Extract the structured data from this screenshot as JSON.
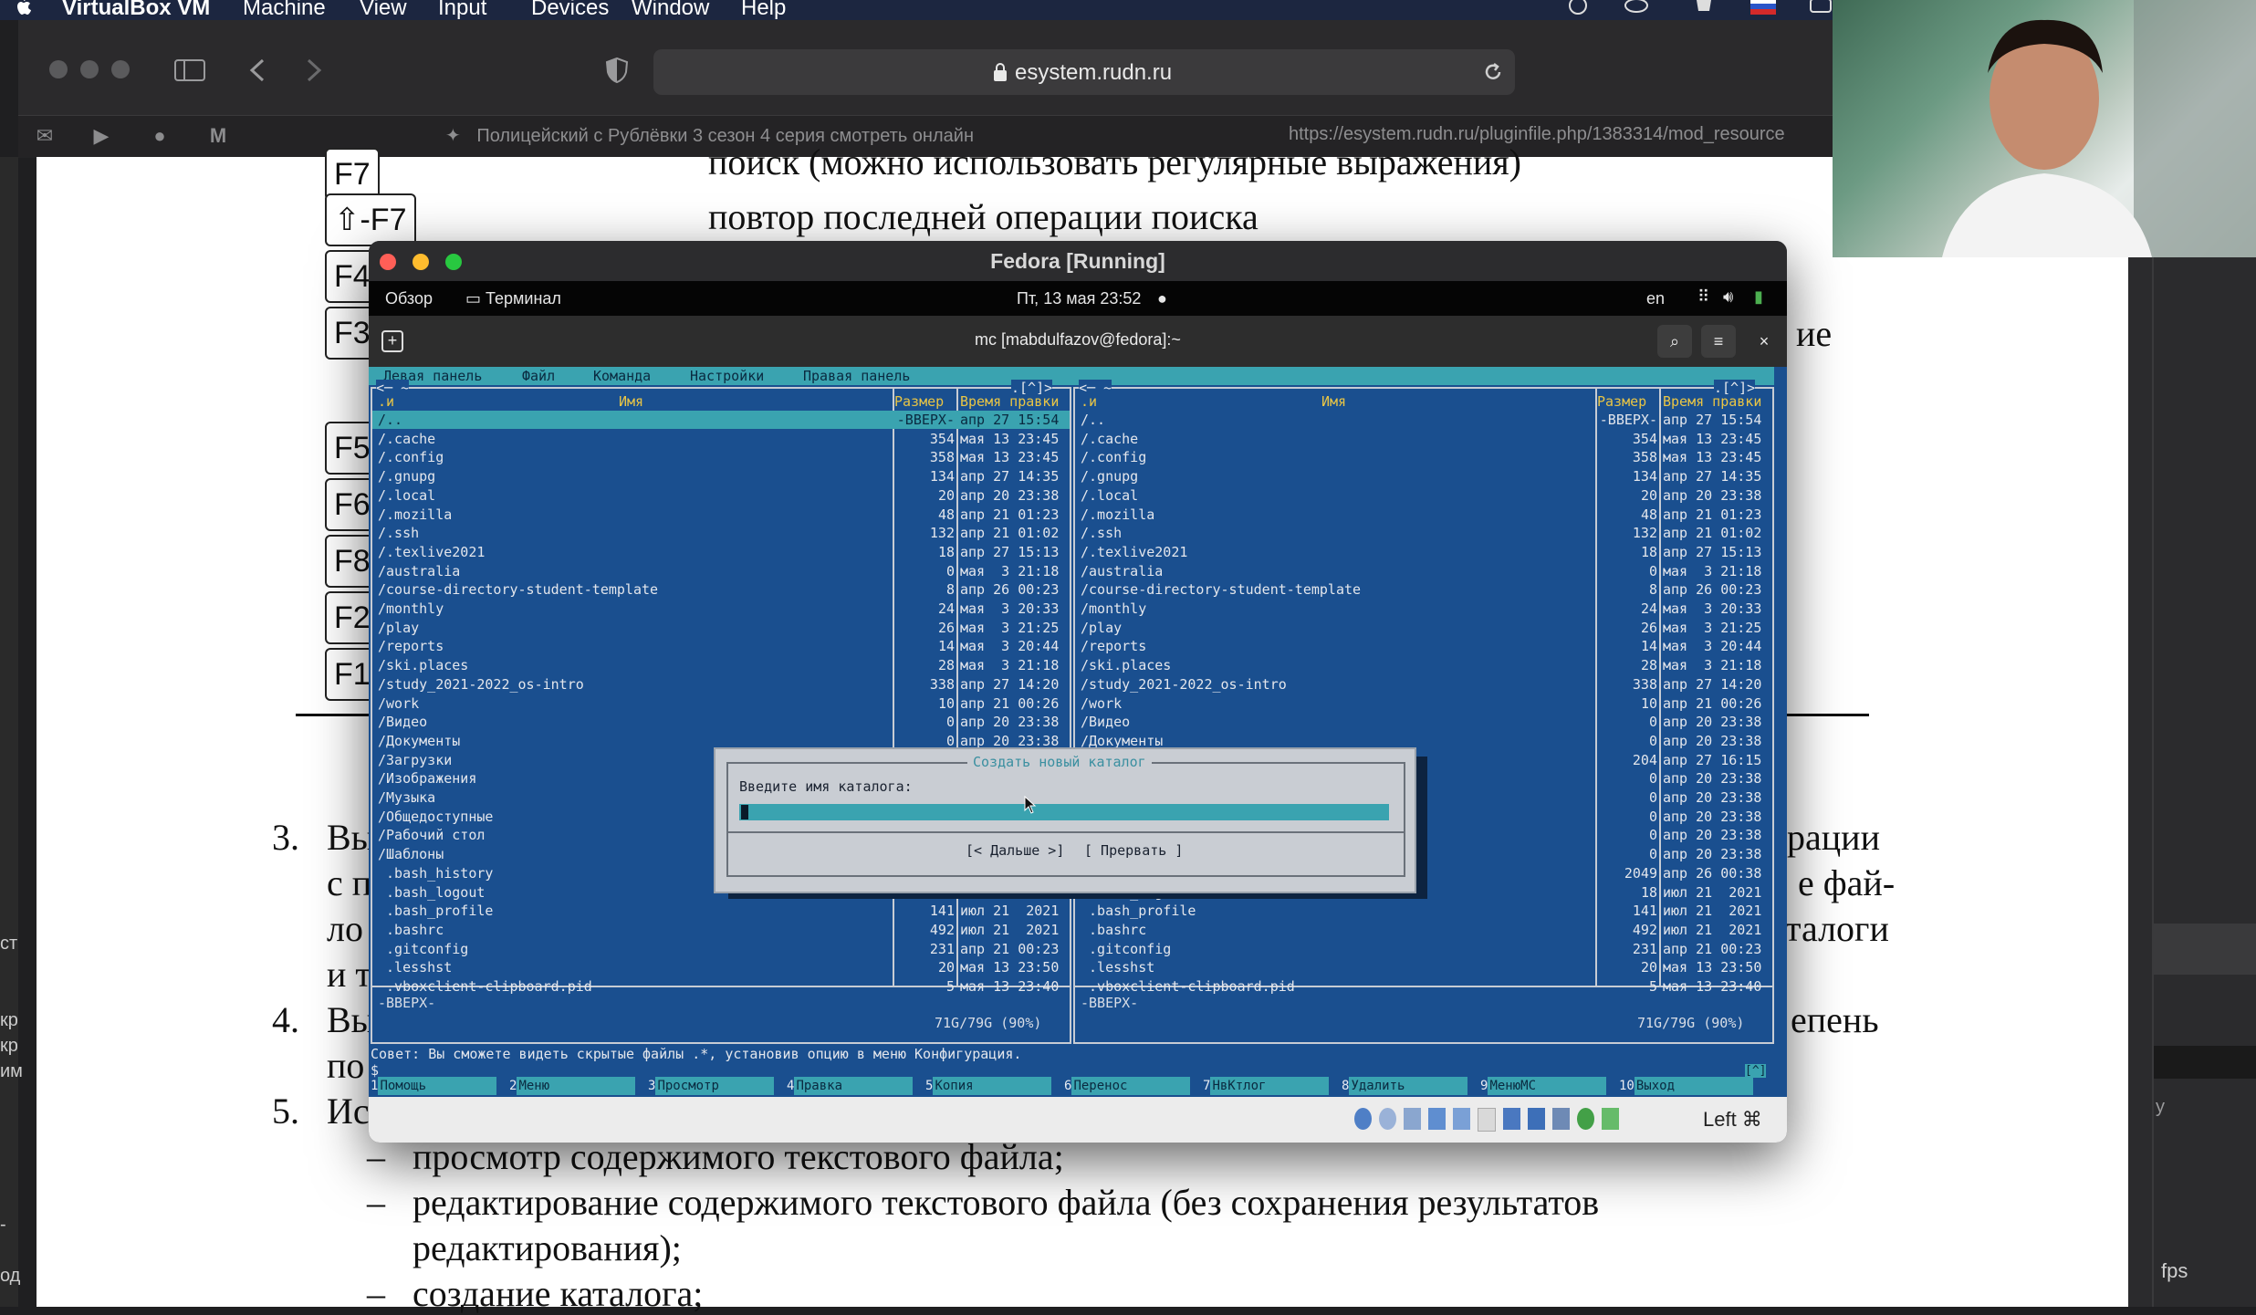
{
  "menubar": {
    "app": "VirtualBox VM",
    "items": [
      "Machine",
      "View",
      "Input",
      "Devices",
      "Window",
      "Help"
    ]
  },
  "browser": {
    "address": "esystem.rudn.ru",
    "tab_left": "Полицейский с Рублёвки 3 сезон 4 серия смотреть онлайн",
    "tab_right": "https://esystem.rudn.ru/pluginfile.php/1383314/mod_resource"
  },
  "doc": {
    "fkeys": [
      "F7",
      "⇧-F7",
      "F4",
      "F3",
      "F5",
      "F6",
      "F8",
      "F2",
      "F1"
    ],
    "line_search": "поиск (можно использовать регулярные выражения)",
    "line_repeat": "повтор последней операции поиска",
    "frag_ie": "ие",
    "item3_num": "3.",
    "item3_a": "Вы",
    "item3_b": "с п",
    "item3_c": "ло",
    "item3_d": "и т",
    "item3_r1": "рации",
    "item3_r2": "е фай-",
    "item3_r3": "талоги",
    "item4_num": "4.",
    "item4_a": "Вы",
    "item4_b": "по",
    "item4_r": "епень",
    "item5_num": "5.",
    "item5_a": "Ис",
    "dash": "–",
    "bullet1": "просмотр содержимого текстового файла;",
    "bullet2": "редактирование содержимого текстового файла (без сохранения результатов",
    "bullet2b": "редактирования);",
    "bullet3": "создание каталога;"
  },
  "gutter": {
    "left_frags": [
      "ст",
      "кр",
      "кр",
      "им",
      "-",
      "од"
    ],
    "fps": "fps",
    "y": "y"
  },
  "vbox": {
    "title": "Fedora [Running]",
    "gnome": {
      "overview": "Обзор",
      "terminal": "Терминал",
      "clock": "Пт, 13 мая  23:52",
      "lang": "en"
    },
    "term_title": "mc [mabdulfazov@fedora]:~",
    "status_host": "Left ⌘"
  },
  "mc": {
    "menu": [
      "Левая панель",
      "Файл",
      "Команда",
      "Настройки",
      "Правая панель"
    ],
    "headers": {
      "n": ".и",
      "name": "Имя",
      "size": "Размер",
      "date": "Время правки"
    },
    "rows": [
      {
        "name": "/..",
        "size": "-ВВЕРХ-",
        "date": "апр 27 15:54"
      },
      {
        "name": "/.cache",
        "size": "354",
        "date": "мая 13 23:45"
      },
      {
        "name": "/.config",
        "size": "358",
        "date": "мая 13 23:45"
      },
      {
        "name": "/.gnupg",
        "size": "134",
        "date": "апр 27 14:35"
      },
      {
        "name": "/.local",
        "size": "20",
        "date": "апр 20 23:38"
      },
      {
        "name": "/.mozilla",
        "size": "48",
        "date": "апр 21 01:23"
      },
      {
        "name": "/.ssh",
        "size": "132",
        "date": "апр 21 01:02"
      },
      {
        "name": "/.texlive2021",
        "size": "18",
        "date": "апр 27 15:13"
      },
      {
        "name": "/australia",
        "size": "0",
        "date": "мая  3 21:18"
      },
      {
        "name": "/course-directory-student-template",
        "size": "8",
        "date": "апр 26 00:23"
      },
      {
        "name": "/monthly",
        "size": "24",
        "date": "мая  3 20:33"
      },
      {
        "name": "/play",
        "size": "26",
        "date": "мая  3 21:25"
      },
      {
        "name": "/reports",
        "size": "14",
        "date": "мая  3 20:44"
      },
      {
        "name": "/ski.places",
        "size": "28",
        "date": "мая  3 21:18"
      },
      {
        "name": "/study_2021-2022_os-intro",
        "size": "338",
        "date": "апр 27 14:20"
      },
      {
        "name": "/work",
        "size": "10",
        "date": "апр 21 00:26"
      },
      {
        "name": "/Видео",
        "size": "0",
        "date": "апр 20 23:38"
      },
      {
        "name": "/Документы",
        "size": "0",
        "date": "апр 20 23:38"
      },
      {
        "name": "/Загрузки",
        "size": "204",
        "date": "апр 27 16:15"
      },
      {
        "name": "/Изображения",
        "size": "0",
        "date": "апр 20 23:38"
      },
      {
        "name": "/Музыка",
        "size": "0",
        "date": "апр 20 23:38"
      },
      {
        "name": "/Общедоступные",
        "size": "0",
        "date": "апр 20 23:38"
      },
      {
        "name": "/Рабочий стол",
        "size": "0",
        "date": "апр 20 23:38"
      },
      {
        "name": "/Шаблоны",
        "size": "0",
        "date": "апр 20 23:38"
      },
      {
        "name": " .bash_history",
        "size": "2049",
        "date": "апр 26 00:38"
      },
      {
        "name": " .bash_logout",
        "size": "18",
        "date": "июл 21  2021"
      },
      {
        "name": " .bash_profile",
        "size": "141",
        "date": "июл 21  2021"
      },
      {
        "name": " .bashrc",
        "size": "492",
        "date": "июл 21  2021"
      },
      {
        "name": " .gitconfig",
        "size": "231",
        "date": "апр 21 00:23"
      },
      {
        "name": " .lesshst",
        "size": "20",
        "date": "мая 13 23:50"
      },
      {
        "name": " .vboxclient-clipboard.pid",
        "size": "5",
        "date": "мая 13 23:40"
      }
    ],
    "footer_left": "-ВВЕРХ-",
    "footer_right": "71G/79G (90%)",
    "hint": "Совет: Вы сможете видеть скрытые файлы .*, установив опцию в меню Конфигурация.",
    "prompt": "$",
    "prompt_right": "[^]",
    "corner_left": "<─ ~",
    "corner_right": ".[^]>",
    "fkeys": [
      {
        "n": "1",
        "l": "Помощь"
      },
      {
        "n": "2",
        "l": "Меню"
      },
      {
        "n": "3",
        "l": "Просмотр"
      },
      {
        "n": "4",
        "l": "Правка"
      },
      {
        "n": "5",
        "l": "Копия"
      },
      {
        "n": "6",
        "l": "Перенос"
      },
      {
        "n": "7",
        "l": "НвКтлог"
      },
      {
        "n": "8",
        "l": "Удалить"
      },
      {
        "n": "9",
        "l": "МенюMC"
      },
      {
        "n": "10",
        "l": "Выход"
      }
    ],
    "dialog": {
      "title": "Создать новый каталог",
      "prompt": "Введите имя каталога:",
      "ok": "[< Дальше >]",
      "cancel": "[ Прервать ]"
    }
  },
  "colors": {
    "mc_blue": "#1a4f8f",
    "mc_cyan": "#3aa3b0",
    "mc_yellow": "#e9c545"
  }
}
